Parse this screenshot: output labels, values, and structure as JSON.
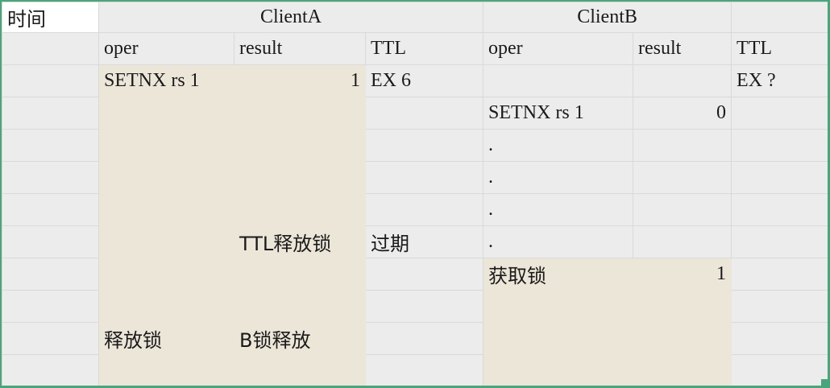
{
  "corner": "时间",
  "client_a": {
    "title": "ClientA",
    "headers": {
      "oper": "oper",
      "result": "result",
      "ttl": "TTL"
    },
    "row1": {
      "oper": "SETNX rs 1",
      "result": "1",
      "ttl": "EX 6"
    },
    "row6": {
      "result": "TTL释放锁",
      "ttl": "过期"
    },
    "row9": {
      "oper": "释放锁",
      "result": "B锁释放"
    }
  },
  "client_b": {
    "title": "ClientB",
    "headers": {
      "oper": "oper",
      "result": "result",
      "ttl": "TTL"
    },
    "row1": {
      "ttl": "EX ?"
    },
    "row2": {
      "oper": "SETNX rs 1",
      "result": "0"
    },
    "dots": ".",
    "row7": {
      "oper": "获取锁",
      "result": "1"
    }
  },
  "colors": {
    "lock_fill": "#ece6d9",
    "cell_fill": "#ececec",
    "grid_line": "#d9d9d9",
    "selection_border": "#4aa57c"
  }
}
